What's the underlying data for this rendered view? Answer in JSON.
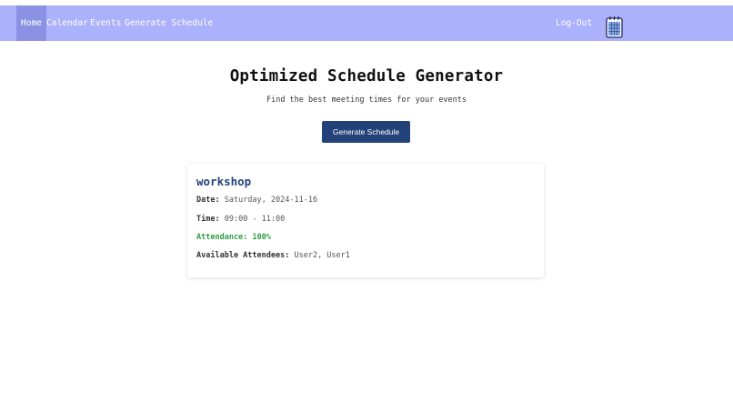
{
  "nav": {
    "items": [
      {
        "label": "Home",
        "active": true
      },
      {
        "label": "Calendar",
        "active": false
      },
      {
        "label": "Events",
        "active": false
      },
      {
        "label": "Generate Schedule",
        "active": false
      }
    ],
    "logout_label": "Log-Out",
    "icon": "calendar-icon",
    "bg_color": "#abb1fa",
    "active_color": "#8b92e3"
  },
  "header": {
    "title": "Optimized Schedule Generator",
    "subtitle": "Find the best meeting times for your events"
  },
  "generate_button": {
    "label": "Generate Schedule",
    "color": "#23427a"
  },
  "result": {
    "title": "workshop",
    "date_label": "Date:",
    "date_value": "Saturday, 2024-11-16",
    "time_label": "Time:",
    "time_value": "09:00 - 11:00",
    "attendance_label": "Attendance:",
    "attendance_value": "100%",
    "attendance_color": "#2f9e44",
    "available_label": "Available Attendees:",
    "available_value": "User2, User1"
  }
}
